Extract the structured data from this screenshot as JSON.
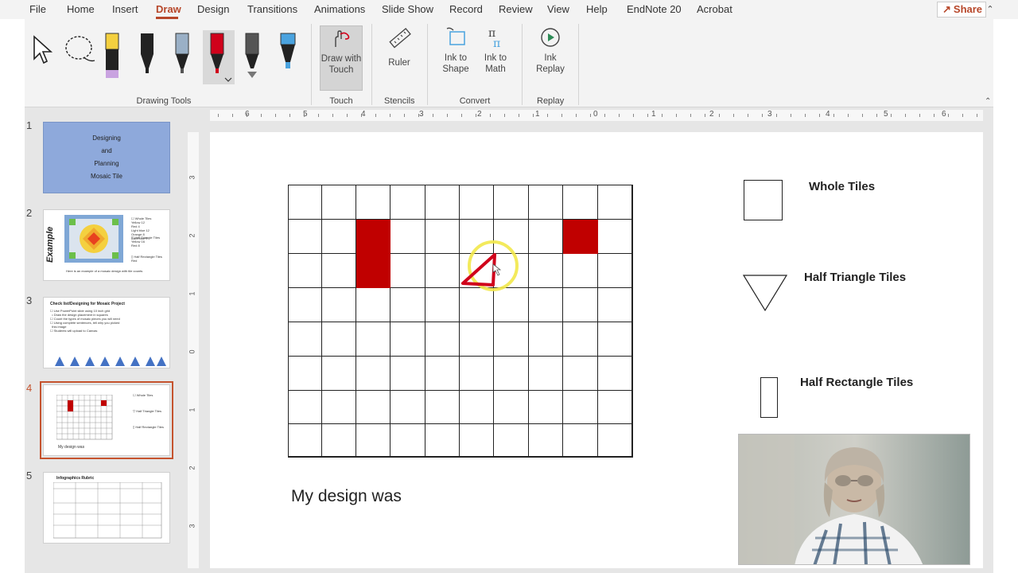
{
  "menu": {
    "tabs": [
      "File",
      "Home",
      "Insert",
      "Draw",
      "Design",
      "Transitions",
      "Animations",
      "Slide Show",
      "Record",
      "Review",
      "View",
      "Help",
      "EndNote 20",
      "Acrobat"
    ],
    "active": "Draw",
    "share_label": "Share"
  },
  "ribbon": {
    "groups": {
      "drawing_tools": "Drawing Tools",
      "touch": "Touch",
      "stencils": "Stencils",
      "convert": "Convert",
      "replay": "Replay"
    },
    "buttons": {
      "draw_with_touch_1": "Draw with",
      "draw_with_touch_2": "Touch",
      "ruler": "Ruler",
      "ink_to_shape_1": "Ink to",
      "ink_to_shape_2": "Shape",
      "ink_to_math_1": "Ink to",
      "ink_to_math_2": "Math",
      "ink_replay_1": "Ink",
      "ink_replay_2": "Replay"
    },
    "pen_colors": [
      "#f4d03f",
      "#222222",
      "#9ab0c6",
      "#d0021b",
      "#555555",
      "#4aa3df"
    ]
  },
  "thumbnails": {
    "numbers": [
      "1",
      "2",
      "3",
      "4",
      "5"
    ],
    "slide1_title_lines": [
      "Designing",
      "and",
      "Planning",
      "Mosaic Tile"
    ],
    "slide1_bg": "#8ea9db",
    "slide2_label": "Example",
    "slide3_title": "Check list/Designing for Mosaic Project",
    "slide4_caption": "My design was",
    "slide5_title": "Infographics Rubric",
    "selected_index": 4,
    "selected_color": "#c5532e"
  },
  "ruler": {
    "labels": [
      "6",
      "5",
      "4",
      "3",
      "2",
      "1",
      "0",
      "1",
      "2",
      "3",
      "4",
      "5",
      "6"
    ],
    "vlabels": [
      "3",
      "2",
      "1",
      "0",
      "1",
      "2",
      "3"
    ]
  },
  "slide": {
    "legend": {
      "whole": "Whole Tiles",
      "half_triangle": "Half Triangle Tiles",
      "half_rectangle": "Half Rectangle Tiles"
    },
    "caption": "My design was",
    "tile_color": "#c00000",
    "ink_color": "#d0021b",
    "laser_color": "#f2e84a"
  }
}
